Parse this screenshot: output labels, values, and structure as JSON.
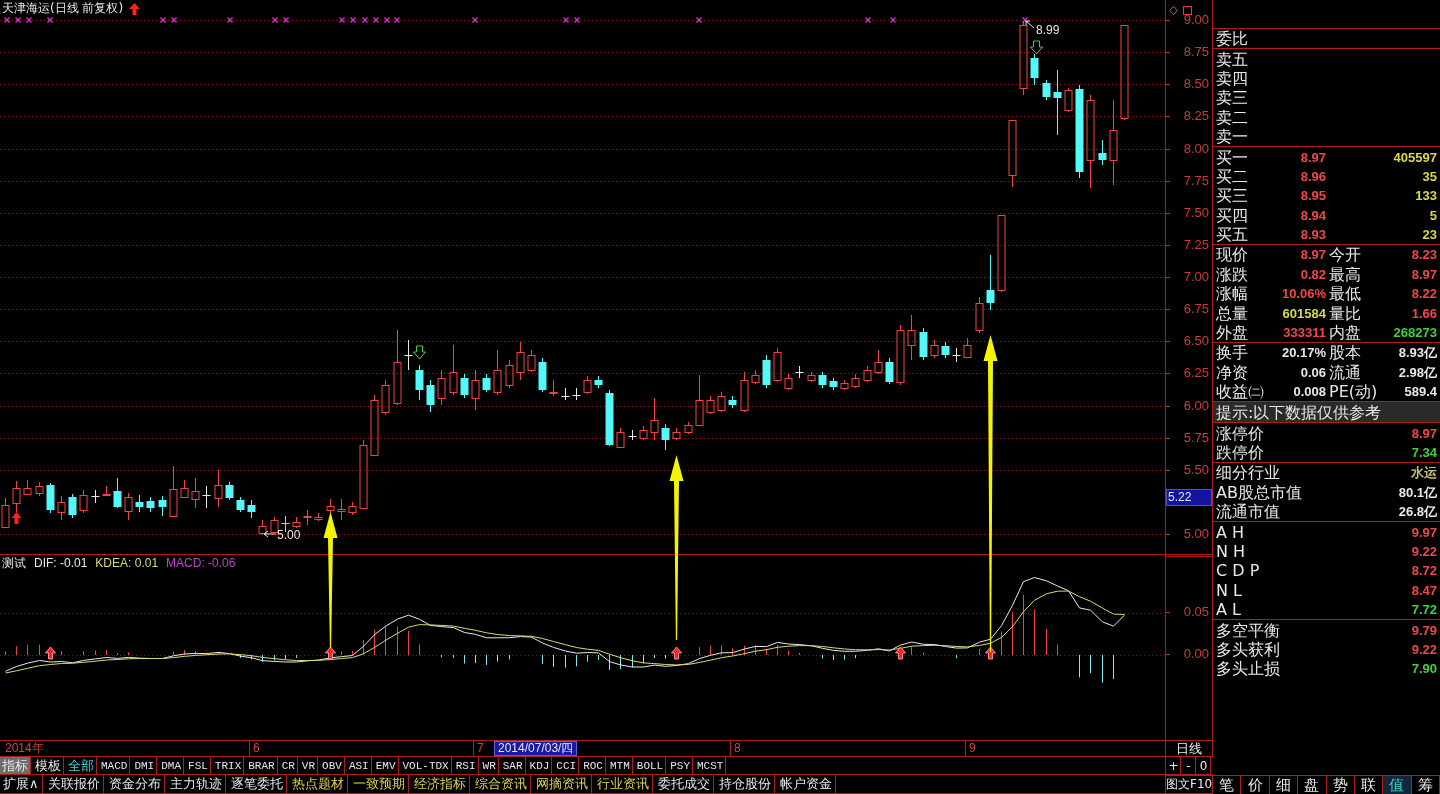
{
  "chart_title": "天津海运(日线 前复权)",
  "price_chart": {
    "ticks": [
      "9.00",
      "8.75",
      "8.50",
      "8.25",
      "8.00",
      "7.75",
      "7.50",
      "7.25",
      "7.00",
      "6.75",
      "6.50",
      "6.25",
      "6.00",
      "5.75",
      "5.50",
      "5.00"
    ],
    "cursor_price": "5.22",
    "high_label": "8.99",
    "low_label": "5.00"
  },
  "indicator_chart": {
    "name": "测试",
    "legend": [
      {
        "label": "DIF: -0.01",
        "color": "#e8e8e8"
      },
      {
        "label": "KDEA: 0.01",
        "color": "#d8d878"
      },
      {
        "label": "MACD: -0.06",
        "color": "#c040d0"
      }
    ],
    "ticks": [
      "0.05",
      "0.00"
    ]
  },
  "date_axis": {
    "labels": [
      "2014年",
      "6",
      "7",
      "8",
      "9"
    ],
    "cursor_date": "2014/07/03/四",
    "period": "日线"
  },
  "mode_tabs": [
    {
      "label": "指标",
      "selected": true
    },
    {
      "label": "模板",
      "selected": false
    }
  ],
  "indicator_tabs": [
    {
      "label": "全部",
      "selected": true
    },
    {
      "label": "MACD",
      "selected": false
    },
    {
      "label": "DMI",
      "selected": false
    },
    {
      "label": "DMA",
      "selected": false
    },
    {
      "label": "FSL",
      "selected": false
    },
    {
      "label": "TRIX",
      "selected": false
    },
    {
      "label": "BRAR",
      "selected": false
    },
    {
      "label": "CR",
      "selected": false
    },
    {
      "label": "VR",
      "selected": false
    },
    {
      "label": "OBV",
      "selected": false
    },
    {
      "label": "ASI",
      "selected": false
    },
    {
      "label": "EMV",
      "selected": false
    },
    {
      "label": "VOL-TDX",
      "selected": false
    },
    {
      "label": "RSI",
      "selected": false
    },
    {
      "label": "WR",
      "selected": false
    },
    {
      "label": "SAR",
      "selected": false
    },
    {
      "label": "KDJ",
      "selected": false
    },
    {
      "label": "CCI",
      "selected": false
    },
    {
      "label": "ROC",
      "selected": false
    },
    {
      "label": "MTM",
      "selected": false
    },
    {
      "label": "BOLL",
      "selected": false
    },
    {
      "label": "PSY",
      "selected": false
    },
    {
      "label": "MCST",
      "selected": false
    }
  ],
  "zoom_buttons": [
    "+",
    "-",
    "0"
  ],
  "function_tabs": [
    {
      "label": "扩展∧",
      "kind": "tool"
    },
    {
      "label": "关联报价",
      "kind": "tool"
    },
    {
      "label": "资金分布",
      "kind": "tool"
    },
    {
      "label": "主力轨迹",
      "kind": "tool"
    },
    {
      "label": "逐笔委托",
      "kind": "tool"
    },
    {
      "label": "热点题材",
      "kind": "info"
    },
    {
      "label": "一致预期",
      "kind": "info"
    },
    {
      "label": "经济指标",
      "kind": "info"
    },
    {
      "label": "综合资讯",
      "kind": "info"
    },
    {
      "label": "网摘资讯",
      "kind": "info"
    },
    {
      "label": "行业资讯",
      "kind": "info"
    },
    {
      "label": "委托成交",
      "kind": "tool"
    },
    {
      "label": "持仓股份",
      "kind": "tool"
    },
    {
      "label": "帐户资金",
      "kind": "tool"
    }
  ],
  "f10_button": "图文F10",
  "quote_panel": {
    "order_ratio_label": "委比",
    "ask_rows": [
      {
        "label": "卖五"
      },
      {
        "label": "卖四"
      },
      {
        "label": "卖三"
      },
      {
        "label": "卖二"
      },
      {
        "label": "卖一"
      }
    ],
    "bid_rows": [
      {
        "label": "买一",
        "price": "8.97",
        "volume": "405597"
      },
      {
        "label": "买二",
        "price": "8.96",
        "volume": "35"
      },
      {
        "label": "买三",
        "price": "8.95",
        "volume": "133"
      },
      {
        "label": "买四",
        "price": "8.94",
        "volume": "5"
      },
      {
        "label": "买五",
        "price": "8.93",
        "volume": "23"
      }
    ],
    "quote_rows": [
      {
        "items": [
          {
            "label": "现价",
            "value": "8.97",
            "color": "#f04848"
          },
          {
            "label": "今开",
            "value": "8.23",
            "color": "#f04848"
          }
        ]
      },
      {
        "items": [
          {
            "label": "涨跌",
            "value": "0.82",
            "color": "#f04848"
          },
          {
            "label": "最高",
            "value": "8.97",
            "color": "#f04848"
          }
        ]
      },
      {
        "items": [
          {
            "label": "涨幅",
            "value": "10.06%",
            "color": "#f04848"
          },
          {
            "label": "最低",
            "value": "8.22",
            "color": "#f04848"
          }
        ]
      },
      {
        "items": [
          {
            "label": "总量",
            "value": "601584",
            "color": "#d8d848"
          },
          {
            "label": "量比",
            "value": "1.66",
            "color": "#f04848"
          }
        ]
      },
      {
        "items": [
          {
            "label": "外盘",
            "value": "333311",
            "color": "#f04848"
          },
          {
            "label": "内盘",
            "value": "268273",
            "color": "#40d040"
          }
        ]
      }
    ],
    "share_rows": [
      {
        "items": [
          {
            "label": "换手",
            "value": "20.17%",
            "color": "#e8e8e8"
          },
          {
            "label": "股本",
            "value": "8.93亿",
            "color": "#e8e8e8"
          }
        ]
      },
      {
        "items": [
          {
            "label": "净资",
            "value": "0.06",
            "color": "#e8e8e8"
          },
          {
            "label": "流通",
            "value": "2.98亿",
            "color": "#e8e8e8"
          }
        ]
      },
      {
        "items": [
          {
            "label": "收益㈡",
            "value": "0.008",
            "color": "#e8e8e8"
          },
          {
            "label": "PE(动)",
            "value": "589.4",
            "color": "#e8e8e8"
          }
        ]
      }
    ],
    "notice": "提示:以下数据仅供参考",
    "limit_rows": [
      {
        "label": "涨停价",
        "value": "8.97",
        "color": "#f04848"
      },
      {
        "label": "跌停价",
        "value": "7.34",
        "color": "#40d040"
      }
    ],
    "industry_rows": [
      {
        "label": "细分行业",
        "value": "水运",
        "color": "#c8c070"
      },
      {
        "label": "AB股总市值",
        "value": "80.1亿",
        "color": "#e8e8e8"
      },
      {
        "label": "流通市值",
        "value": "26.8亿",
        "color": "#e8e8e8"
      }
    ],
    "pivot_rows": [
      {
        "label": "A H",
        "value": "9.97",
        "color": "#f04848"
      },
      {
        "label": "N H",
        "value": "9.22",
        "color": "#f04848"
      },
      {
        "label": "C D P",
        "value": "8.72",
        "color": "#f04848"
      },
      {
        "label": "N L",
        "value": "8.47",
        "color": "#f04848"
      },
      {
        "label": "A L",
        "value": "7.72",
        "color": "#40d040"
      }
    ],
    "balance_rows": [
      {
        "label": "多空平衡",
        "value": "9.79",
        "color": "#f04848"
      },
      {
        "label": "多头获利",
        "value": "9.22",
        "color": "#f04848"
      },
      {
        "label": "多头止损",
        "value": "7.90",
        "color": "#40d040"
      }
    ]
  },
  "panel_tabs": [
    {
      "label": "笔",
      "selected": false
    },
    {
      "label": "价",
      "selected": false
    },
    {
      "label": "细",
      "selected": false
    },
    {
      "label": "盘",
      "selected": false
    },
    {
      "label": "势",
      "selected": false
    },
    {
      "label": "联",
      "selected": false
    },
    {
      "label": "值",
      "selected": true
    },
    {
      "label": "筹",
      "selected": false
    }
  ]
}
